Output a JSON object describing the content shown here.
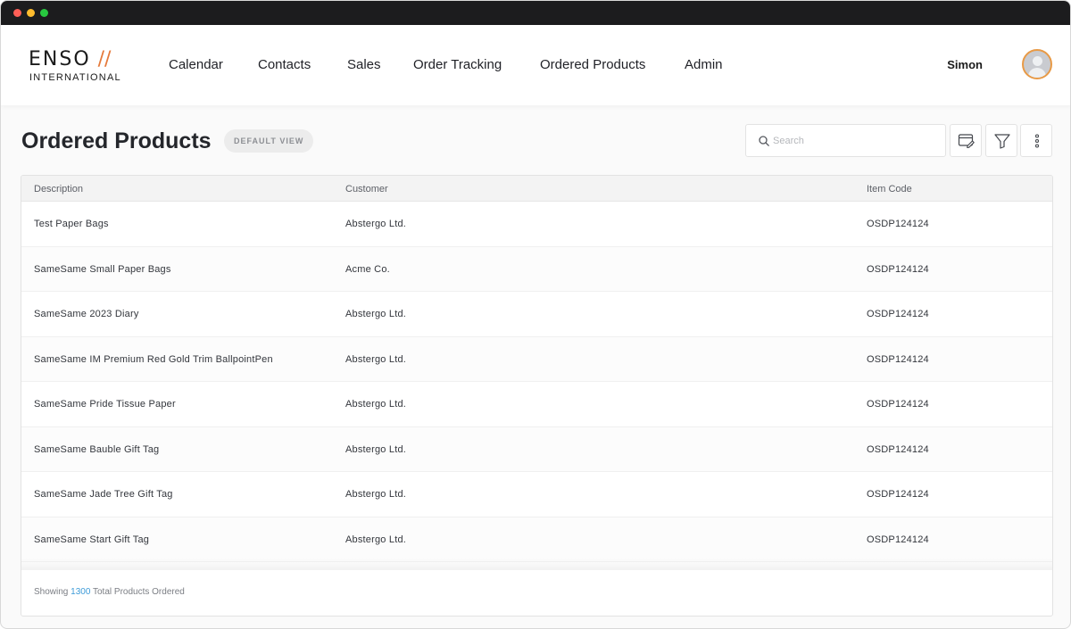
{
  "app": {
    "logo_main": "ENSO",
    "logo_slash": "//",
    "logo_sub": "INTERNATIONAL"
  },
  "nav": {
    "items": [
      {
        "label": "Calendar"
      },
      {
        "label": "Contacts"
      },
      {
        "label": "Sales"
      },
      {
        "label": "Order Tracking"
      },
      {
        "label": "Ordered Products"
      },
      {
        "label": "Admin"
      }
    ]
  },
  "user": {
    "name": "Simon"
  },
  "page": {
    "title": "Ordered Products",
    "view_badge": "DEFAULT VIEW"
  },
  "search": {
    "placeholder": "Search",
    "value": ""
  },
  "table": {
    "columns": [
      "Description",
      "Customer",
      "Item Code"
    ],
    "rows": [
      {
        "description": "Test Paper Bags",
        "customer": "Abstergo Ltd.",
        "item_code": "OSDP124124"
      },
      {
        "description": "SameSame Small Paper Bags",
        "customer": "Acme Co.",
        "item_code": "OSDP124124"
      },
      {
        "description": "SameSame 2023 Diary",
        "customer": "Abstergo Ltd.",
        "item_code": "OSDP124124"
      },
      {
        "description": "SameSame IM Premium Red Gold Trim BallpointPen",
        "customer": "Abstergo Ltd.",
        "item_code": "OSDP124124"
      },
      {
        "description": "SameSame Pride Tissue Paper",
        "customer": "Abstergo Ltd.",
        "item_code": "OSDP124124"
      },
      {
        "description": "SameSame Bauble Gift Tag",
        "customer": "Abstergo Ltd.",
        "item_code": "OSDP124124"
      },
      {
        "description": "SameSame Jade Tree Gift Tag",
        "customer": "Abstergo Ltd.",
        "item_code": "OSDP124124"
      },
      {
        "description": "SameSame Start Gift Tag",
        "customer": "Abstergo Ltd.",
        "item_code": "OSDP124124"
      }
    ]
  },
  "footer": {
    "prefix": "Showing",
    "count": "1300",
    "suffix": "Total Products Ordered"
  },
  "icons": {
    "search": "search-icon",
    "edit_view": "edit-view-icon",
    "filter": "filter-icon",
    "more": "more-vertical-icon",
    "avatar": "user-avatar-icon"
  },
  "colors": {
    "brand_accent": "#e5793a",
    "avatar_ring": "#e89a46",
    "link_count": "#3d9bd8",
    "title_bar": "#1c1c1e"
  }
}
